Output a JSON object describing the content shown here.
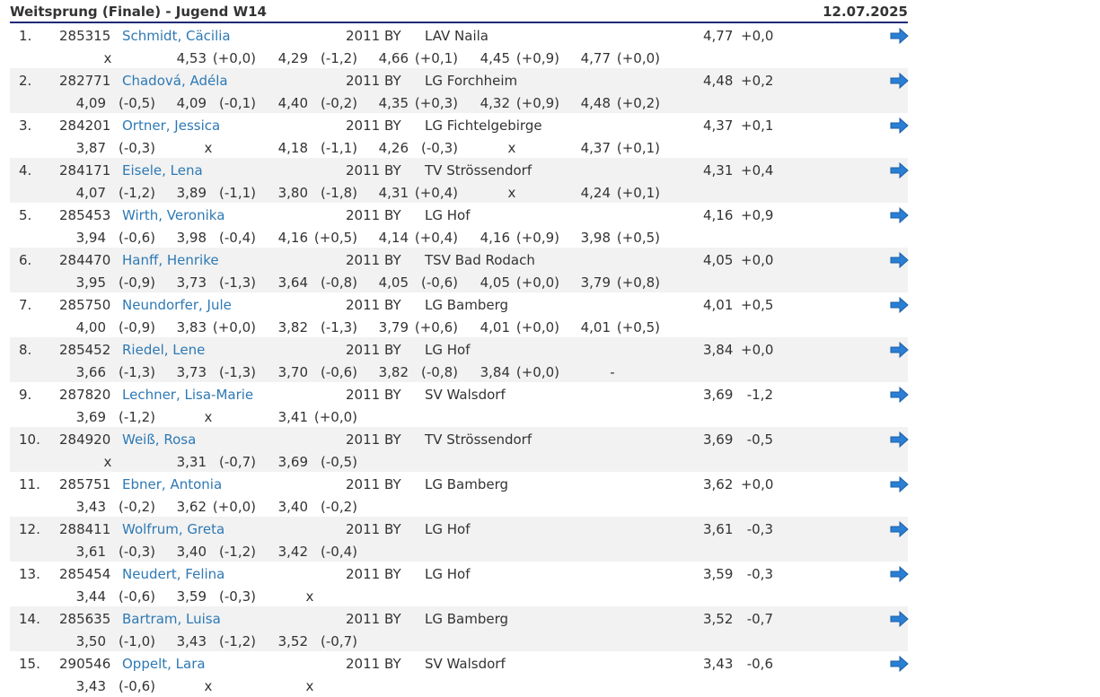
{
  "header": {
    "title": "Weitsprung (Finale) - Jugend W14",
    "date": "12.07.2025"
  },
  "colors": {
    "link": "#2e79b4",
    "arrow": "#2a7fd4",
    "rule": "#1e2a78",
    "stripe": "#f2f2f2"
  },
  "icons": {
    "detail": "arrow-right-icon"
  },
  "results": [
    {
      "rank": "1.",
      "bib": "285315",
      "name": "Schmidt, Cäcilia",
      "year": "2011",
      "state": "BY",
      "club": "LAV Naila",
      "best": "4,77",
      "wind": "+0,0",
      "attempts": [
        {
          "v": "x",
          "w": ""
        },
        {
          "v": "4,53",
          "w": "(+0,0)"
        },
        {
          "v": "4,29",
          "w": "(-1,2)"
        },
        {
          "v": "4,66",
          "w": "(+0,1)"
        },
        {
          "v": "4,45",
          "w": "(+0,9)"
        },
        {
          "v": "4,77",
          "w": "(+0,0)"
        }
      ]
    },
    {
      "rank": "2.",
      "bib": "282771",
      "name": "Chadová, Adéla",
      "year": "2011",
      "state": "BY",
      "club": "LG Forchheim",
      "best": "4,48",
      "wind": "+0,2",
      "attempts": [
        {
          "v": "4,09",
          "w": "(-0,5)"
        },
        {
          "v": "4,09",
          "w": "(-0,1)"
        },
        {
          "v": "4,40",
          "w": "(-0,2)"
        },
        {
          "v": "4,35",
          "w": "(+0,3)"
        },
        {
          "v": "4,32",
          "w": "(+0,9)"
        },
        {
          "v": "4,48",
          "w": "(+0,2)"
        }
      ]
    },
    {
      "rank": "3.",
      "bib": "284201",
      "name": "Ortner, Jessica",
      "year": "2011",
      "state": "BY",
      "club": "LG Fichtelgebirge",
      "best": "4,37",
      "wind": "+0,1",
      "attempts": [
        {
          "v": "3,87",
          "w": "(-0,3)"
        },
        {
          "v": "x",
          "w": ""
        },
        {
          "v": "4,18",
          "w": "(-1,1)"
        },
        {
          "v": "4,26",
          "w": "(-0,3)"
        },
        {
          "v": "x",
          "w": ""
        },
        {
          "v": "4,37",
          "w": "(+0,1)"
        }
      ]
    },
    {
      "rank": "4.",
      "bib": "284171",
      "name": "Eisele, Lena",
      "year": "2011",
      "state": "BY",
      "club": "TV Strössendorf",
      "best": "4,31",
      "wind": "+0,4",
      "attempts": [
        {
          "v": "4,07",
          "w": "(-1,2)"
        },
        {
          "v": "3,89",
          "w": "(-1,1)"
        },
        {
          "v": "3,80",
          "w": "(-1,8)"
        },
        {
          "v": "4,31",
          "w": "(+0,4)"
        },
        {
          "v": "x",
          "w": ""
        },
        {
          "v": "4,24",
          "w": "(+0,1)"
        }
      ]
    },
    {
      "rank": "5.",
      "bib": "285453",
      "name": "Wirth, Veronika",
      "year": "2011",
      "state": "BY",
      "club": "LG Hof",
      "best": "4,16",
      "wind": "+0,9",
      "attempts": [
        {
          "v": "3,94",
          "w": "(-0,6)"
        },
        {
          "v": "3,98",
          "w": "(-0,4)"
        },
        {
          "v": "4,16",
          "w": "(+0,5)"
        },
        {
          "v": "4,14",
          "w": "(+0,4)"
        },
        {
          "v": "4,16",
          "w": "(+0,9)"
        },
        {
          "v": "3,98",
          "w": "(+0,5)"
        }
      ]
    },
    {
      "rank": "6.",
      "bib": "284470",
      "name": "Hanff, Henrike",
      "year": "2011",
      "state": "BY",
      "club": "TSV Bad Rodach",
      "best": "4,05",
      "wind": "+0,0",
      "attempts": [
        {
          "v": "3,95",
          "w": "(-0,9)"
        },
        {
          "v": "3,73",
          "w": "(-1,3)"
        },
        {
          "v": "3,64",
          "w": "(-0,8)"
        },
        {
          "v": "4,05",
          "w": "(-0,6)"
        },
        {
          "v": "4,05",
          "w": "(+0,0)"
        },
        {
          "v": "3,79",
          "w": "(+0,8)"
        }
      ]
    },
    {
      "rank": "7.",
      "bib": "285750",
      "name": "Neundorfer, Jule",
      "year": "2011",
      "state": "BY",
      "club": "LG Bamberg",
      "best": "4,01",
      "wind": "+0,5",
      "attempts": [
        {
          "v": "4,00",
          "w": "(-0,9)"
        },
        {
          "v": "3,83",
          "w": "(+0,0)"
        },
        {
          "v": "3,82",
          "w": "(-1,3)"
        },
        {
          "v": "3,79",
          "w": "(+0,6)"
        },
        {
          "v": "4,01",
          "w": "(+0,0)"
        },
        {
          "v": "4,01",
          "w": "(+0,5)"
        }
      ]
    },
    {
      "rank": "8.",
      "bib": "285452",
      "name": "Riedel, Lene",
      "year": "2011",
      "state": "BY",
      "club": "LG Hof",
      "best": "3,84",
      "wind": "+0,0",
      "attempts": [
        {
          "v": "3,66",
          "w": "(-1,3)"
        },
        {
          "v": "3,73",
          "w": "(-1,3)"
        },
        {
          "v": "3,70",
          "w": "(-0,6)"
        },
        {
          "v": "3,82",
          "w": "(-0,8)"
        },
        {
          "v": "3,84",
          "w": "(+0,0)"
        },
        {
          "v": "-",
          "w": ""
        }
      ]
    },
    {
      "rank": "9.",
      "bib": "287820",
      "name": "Lechner, Lisa-Marie",
      "year": "2011",
      "state": "BY",
      "club": "SV Walsdorf",
      "best": "3,69",
      "wind": "-1,2",
      "attempts": [
        {
          "v": "3,69",
          "w": "(-1,2)"
        },
        {
          "v": "x",
          "w": ""
        },
        {
          "v": "3,41",
          "w": "(+0,0)"
        }
      ]
    },
    {
      "rank": "10.",
      "bib": "284920",
      "name": "Weiß, Rosa",
      "year": "2011",
      "state": "BY",
      "club": "TV Strössendorf",
      "best": "3,69",
      "wind": "-0,5",
      "attempts": [
        {
          "v": "x",
          "w": ""
        },
        {
          "v": "3,31",
          "w": "(-0,7)"
        },
        {
          "v": "3,69",
          "w": "(-0,5)"
        }
      ]
    },
    {
      "rank": "11.",
      "bib": "285751",
      "name": "Ebner, Antonia",
      "year": "2011",
      "state": "BY",
      "club": "LG Bamberg",
      "best": "3,62",
      "wind": "+0,0",
      "attempts": [
        {
          "v": "3,43",
          "w": "(-0,2)"
        },
        {
          "v": "3,62",
          "w": "(+0,0)"
        },
        {
          "v": "3,40",
          "w": "(-0,2)"
        }
      ]
    },
    {
      "rank": "12.",
      "bib": "288411",
      "name": "Wolfrum, Greta",
      "year": "2011",
      "state": "BY",
      "club": "LG Hof",
      "best": "3,61",
      "wind": "-0,3",
      "attempts": [
        {
          "v": "3,61",
          "w": "(-0,3)"
        },
        {
          "v": "3,40",
          "w": "(-1,2)"
        },
        {
          "v": "3,42",
          "w": "(-0,4)"
        }
      ]
    },
    {
      "rank": "13.",
      "bib": "285454",
      "name": "Neudert, Felina",
      "year": "2011",
      "state": "BY",
      "club": "LG Hof",
      "best": "3,59",
      "wind": "-0,3",
      "attempts": [
        {
          "v": "3,44",
          "w": "(-0,6)"
        },
        {
          "v": "3,59",
          "w": "(-0,3)"
        },
        {
          "v": "x",
          "w": ""
        }
      ]
    },
    {
      "rank": "14.",
      "bib": "285635",
      "name": "Bartram, Luisa",
      "year": "2011",
      "state": "BY",
      "club": "LG Bamberg",
      "best": "3,52",
      "wind": "-0,7",
      "attempts": [
        {
          "v": "3,50",
          "w": "(-1,0)"
        },
        {
          "v": "3,43",
          "w": "(-1,2)"
        },
        {
          "v": "3,52",
          "w": "(-0,7)"
        }
      ]
    },
    {
      "rank": "15.",
      "bib": "290546",
      "name": "Oppelt, Lara",
      "year": "2011",
      "state": "BY",
      "club": "SV Walsdorf",
      "best": "3,43",
      "wind": "-0,6",
      "attempts": [
        {
          "v": "3,43",
          "w": "(-0,6)"
        },
        {
          "v": "x",
          "w": ""
        },
        {
          "v": "x",
          "w": ""
        }
      ]
    }
  ]
}
